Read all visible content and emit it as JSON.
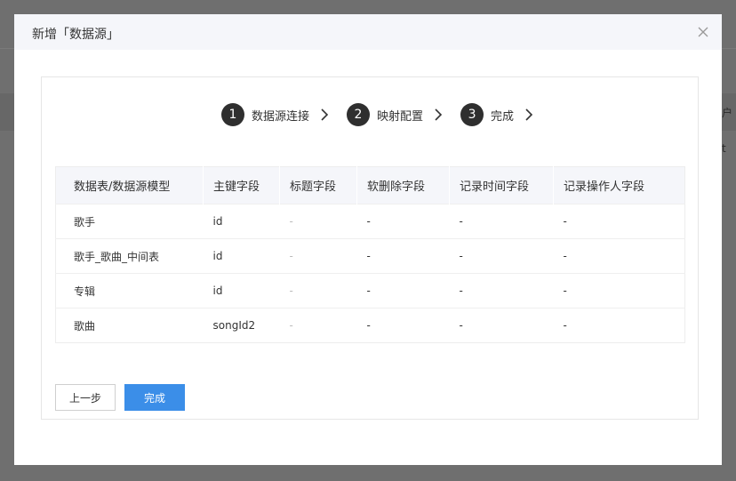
{
  "background": {
    "peek_text_1": "户",
    "peek_text_2": "t"
  },
  "dialog": {
    "title": "新增「数据源」",
    "close_icon": "close-icon"
  },
  "steps": [
    {
      "number": "1",
      "label": "数据源连接"
    },
    {
      "number": "2",
      "label": "映射配置"
    },
    {
      "number": "3",
      "label": "完成"
    }
  ],
  "table": {
    "columns": [
      "数据表/数据源模型",
      "主键字段",
      "标题字段",
      "软删除字段",
      "记录时间字段",
      "记录操作人字段"
    ],
    "rows": [
      [
        "歌手",
        "id",
        "-",
        "-",
        "-",
        "-"
      ],
      [
        "歌手_歌曲_中间表",
        "id",
        "-",
        "-",
        "-",
        "-"
      ],
      [
        "专辑",
        "id",
        "-",
        "-",
        "-",
        "-"
      ],
      [
        "歌曲",
        "songId2",
        "-",
        "-",
        "-",
        "-"
      ]
    ]
  },
  "buttons": {
    "prev_label": "上一步",
    "done_label": "完成"
  },
  "colors": {
    "primary": "#3b8ee8",
    "step_circle": "#2f2f2f",
    "header_bg": "#f5f6fa"
  }
}
